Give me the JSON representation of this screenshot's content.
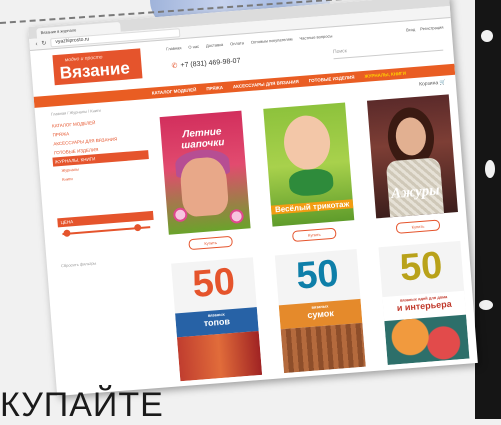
{
  "browser": {
    "tab_title": "Вязание в журнале",
    "url": "vyazhiprosto.ru"
  },
  "site": {
    "logo_sub": "модно и просто",
    "logo_main": "Вязание",
    "phone": "+7 (831) 469-98-07",
    "top_nav": [
      "Главная",
      "О нас",
      "Доставка",
      "Оплата",
      "Оптовым покупателям",
      "Частные вопросы"
    ],
    "account": [
      "Вход",
      "Регистрация"
    ],
    "search_placeholder": "Поиск",
    "cart_label": "Корзина",
    "breadcrumbs": "Главная / Журналы / Книги"
  },
  "catnav": {
    "items": [
      {
        "label": "КАТАЛОГ МОДЕЛЕЙ",
        "active": false
      },
      {
        "label": "ПРЯЖА",
        "active": false
      },
      {
        "label": "АКСЕССУАРЫ ДЛЯ ВЯЗАНИЯ",
        "active": false
      },
      {
        "label": "ГОТОВЫЕ ИЗДЕЛИЯ",
        "active": false
      },
      {
        "label": "ЖУРНАЛЫ, КНИГИ",
        "active": true
      }
    ]
  },
  "sidebar": {
    "items": [
      {
        "label": "КАТАЛОГ МОДЕЛЕЙ",
        "active": false
      },
      {
        "label": "ПРЯЖА",
        "active": false
      },
      {
        "label": "АКСЕССУАРЫ ДЛЯ ВЯЗАНИЯ",
        "active": false
      },
      {
        "label": "ГОТОВЫЕ ИЗДЕЛИЯ",
        "active": false
      },
      {
        "label": "ЖУРНАЛЫ, КНИГИ",
        "active": true
      }
    ],
    "subitems": [
      "Журналы",
      "Книги"
    ],
    "filter_title": "ЦЕНА",
    "slider_low": 0.05,
    "slider_high": 0.85,
    "footer": "Сбросить фильтры"
  },
  "products": [
    {
      "title": "Летние шапочки",
      "buy": "Купить"
    },
    {
      "title": "Весёлый трикотаж",
      "buy": "Купить"
    },
    {
      "title": "Ажуры",
      "buy": "Купить"
    },
    {
      "number": "50",
      "small": "вязаных",
      "word": "топов",
      "buy": "Купить"
    },
    {
      "number": "50",
      "small": "вязаных",
      "word": "сумок",
      "buy": "Купить"
    },
    {
      "number": "50",
      "small": "вязаных идей для дома",
      "word": "и интерьера",
      "buy": "Купить"
    }
  ],
  "caption": "КУПАЙТЕ",
  "colors": {
    "brand": "#e5542c",
    "nav": "#e95d23",
    "accent": "#ffd200"
  }
}
